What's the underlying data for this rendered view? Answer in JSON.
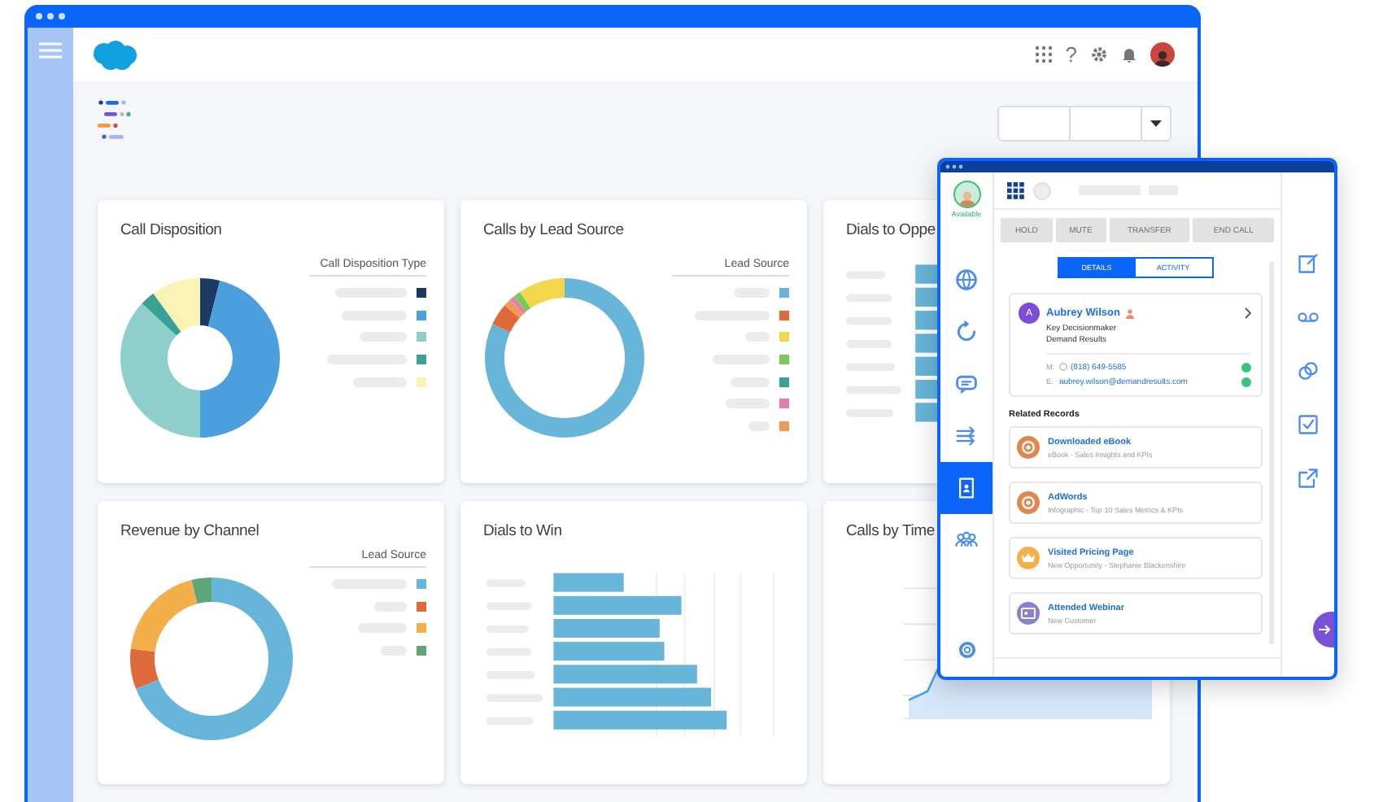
{
  "header": {
    "help": "?"
  },
  "cards": [
    {
      "kind": "donut",
      "title": "Call Disposition",
      "legend_title": "Call Disposition Type",
      "legend": [
        {
          "color": "#1b3a64"
        },
        {
          "color": "#4a9fdc"
        },
        {
          "color": "#8fcfcb"
        },
        {
          "color": "#3aa196"
        },
        {
          "color": "#fbf3b5"
        }
      ]
    },
    {
      "kind": "donut",
      "title": "Calls by Lead Source",
      "legend_title": "Lead Source",
      "legend": [
        {
          "color": "#67b5d8"
        },
        {
          "color": "#dd6a38"
        },
        {
          "color": "#f2d64b"
        },
        {
          "color": "#7ac95b"
        },
        {
          "color": "#3aa196"
        },
        {
          "color": "#e27fb0"
        },
        {
          "color": "#ef9b55"
        }
      ]
    },
    {
      "kind": "bars",
      "title": "Dials to Oppe"
    },
    {
      "kind": "donut",
      "title": "Revenue by Channel",
      "legend_title": "Lead Source",
      "legend": [
        {
          "color": "#67b5d8"
        },
        {
          "color": "#dd6a38"
        },
        {
          "color": "#f3b04a"
        },
        {
          "color": "#5fa57a"
        }
      ]
    },
    {
      "kind": "bars",
      "title": "Dials to Win"
    },
    {
      "kind": "line",
      "title": "Calls by Time"
    }
  ],
  "dialer": {
    "status": "Available",
    "rail": [
      {
        "selected": false
      },
      {
        "selected": false
      },
      {
        "selected": false
      },
      {
        "selected": false
      },
      {
        "selected": true
      },
      {
        "selected": false
      }
    ],
    "controls": [
      {
        "label": "HOLD",
        "disabled": true
      },
      {
        "label": "MUTE",
        "disabled": true
      },
      {
        "label": "TRANSFER",
        "disabled": true
      },
      {
        "label": "END CALL",
        "disabled": true
      }
    ],
    "tabs": [
      {
        "label": "DETAILS",
        "selected": true
      },
      {
        "label": "ACTIVITY",
        "selected": false
      }
    ],
    "contact": {
      "initial": "A",
      "name": "Aubrey Wilson",
      "title": "Key Decisionmaker",
      "company": "Demand Results",
      "phone_label": "M:",
      "phone": "(818) 649-5585",
      "email_label": "E:",
      "email": "aubrey.wilson@demandresults.com"
    },
    "related_title": "Related Records",
    "records": [
      {
        "title": "Downloaded eBook",
        "subtitle": "eBook - Sales Insights and KPIs",
        "color": "#e0874f"
      },
      {
        "title": "AdWords",
        "subtitle": "Infographic - Top 10 Sales Metrics & KPIs",
        "color": "#e0874f"
      },
      {
        "title": "Visited Pricing Page",
        "subtitle": "New Opportunity - Stephanie Blackenshire",
        "color": "#f3b04a"
      },
      {
        "title": "Attended Webinar",
        "subtitle": "New Customer",
        "color": "#8a7fd6"
      }
    ]
  }
}
